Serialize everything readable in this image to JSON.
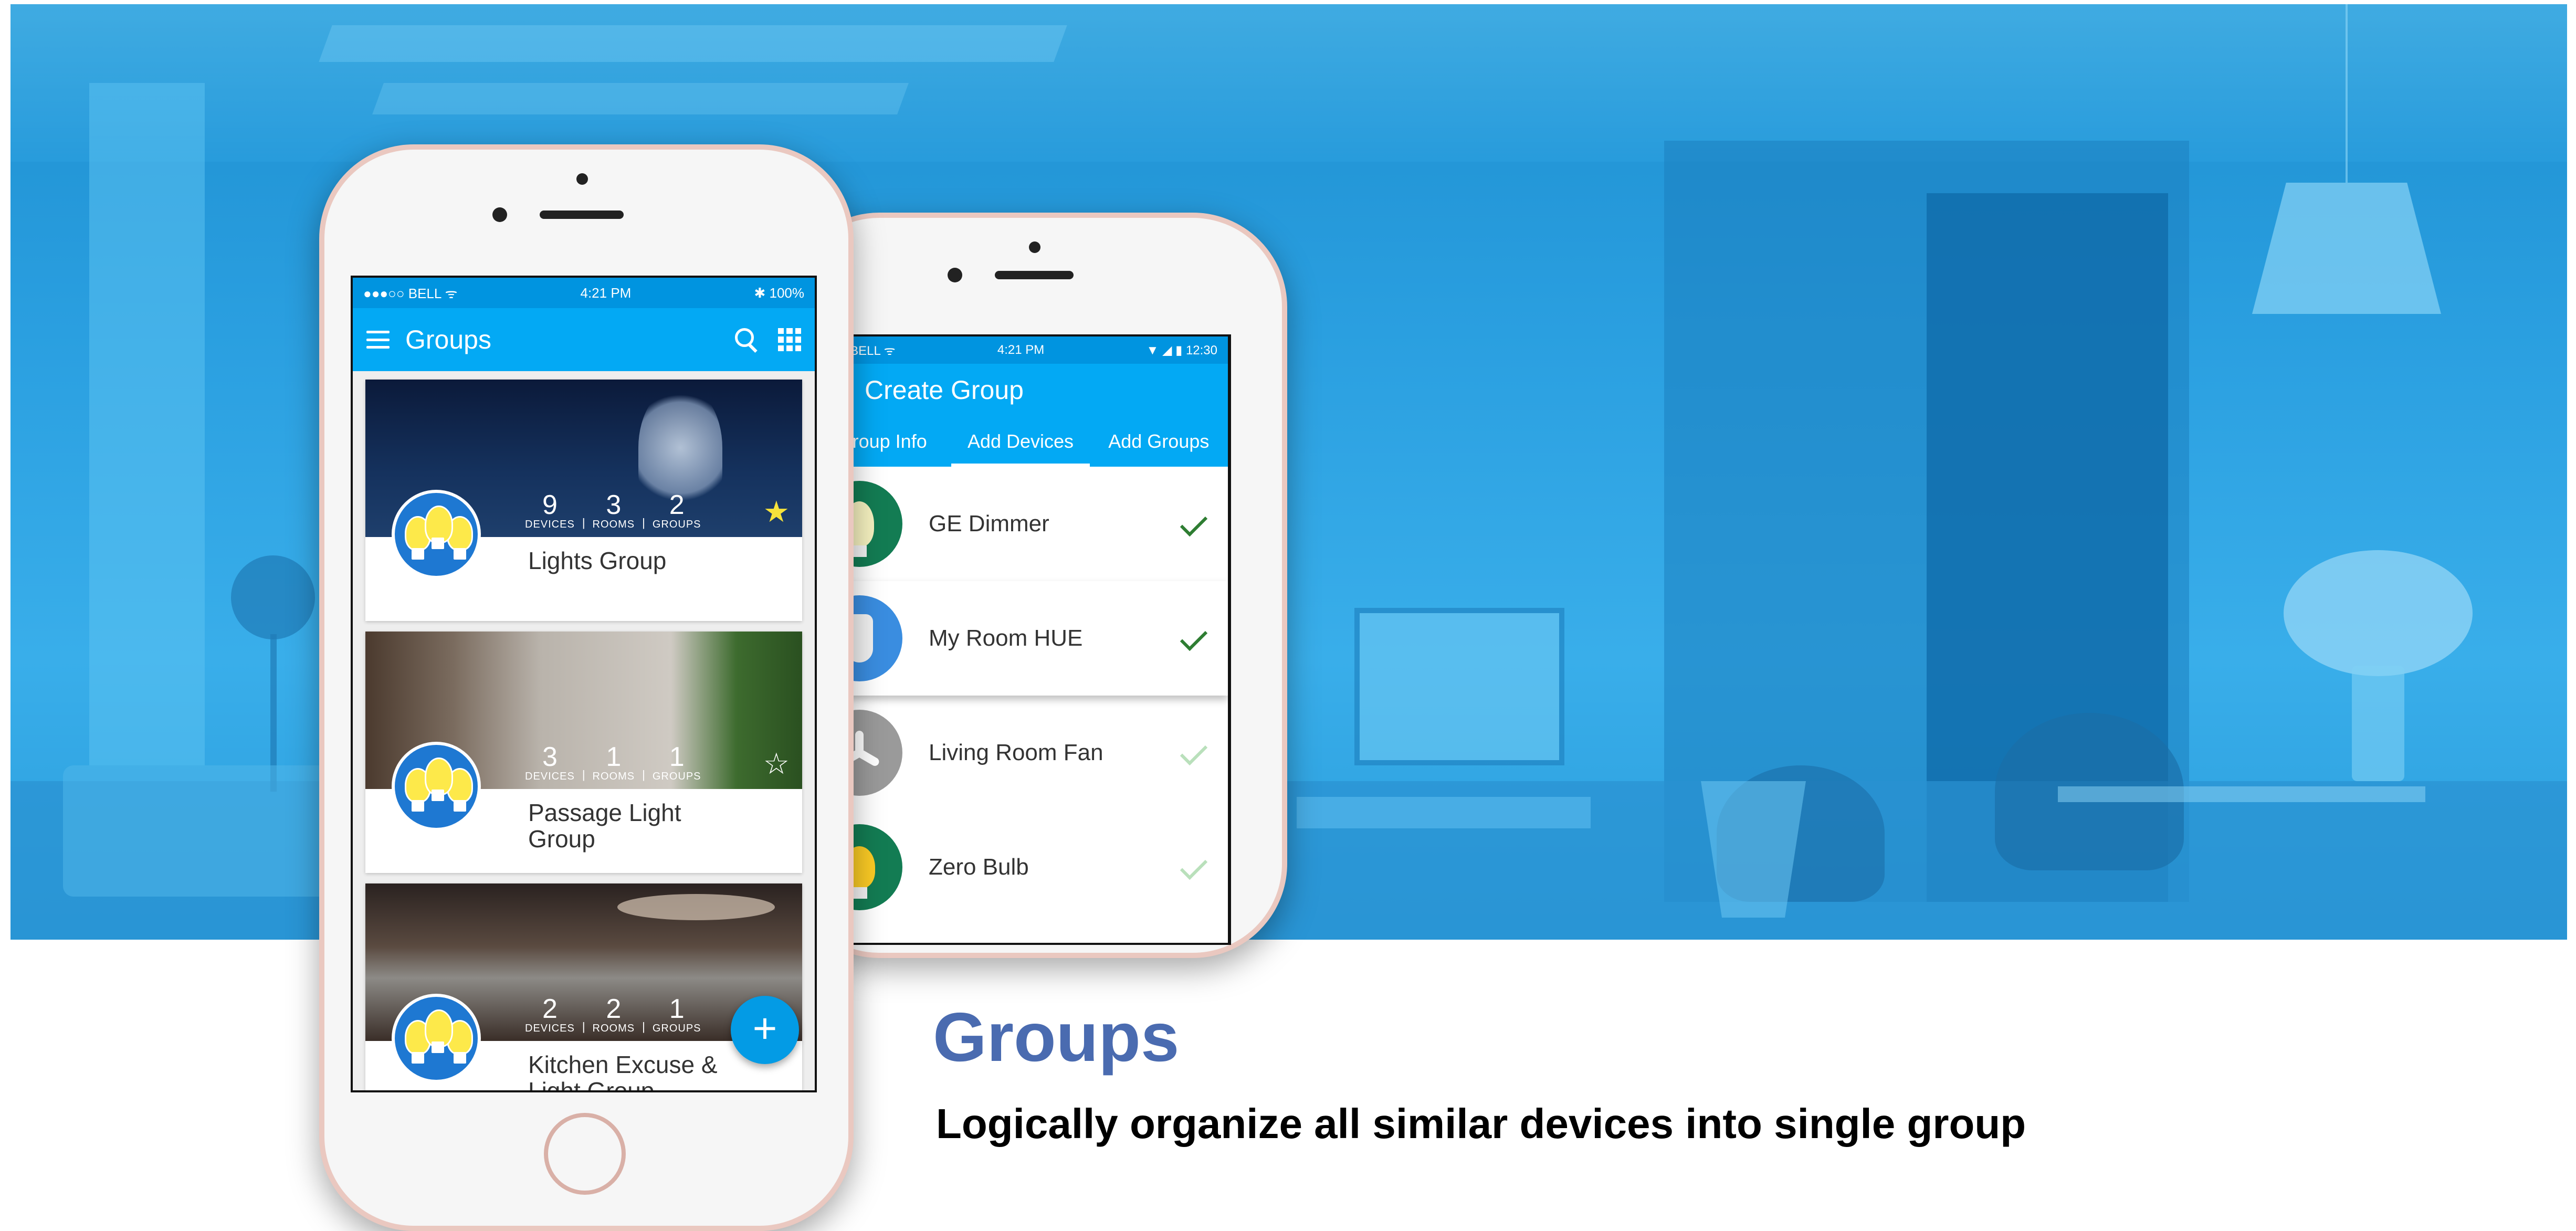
{
  "phone_groups": {
    "status": {
      "carrier": "●●●○○ BELL ᯤ",
      "time": "4:21 PM",
      "battery": "✱ 100%"
    },
    "title": "Groups",
    "cards": [
      {
        "devices": "9",
        "rooms": "3",
        "groups": "2",
        "name": "Lights Group",
        "favorite": true
      },
      {
        "devices": "3",
        "rooms": "1",
        "groups": "1",
        "name": "Passage Light Group",
        "favorite": false
      },
      {
        "devices": "2",
        "rooms": "2",
        "groups": "1",
        "name": "Kitchen Excuse & Light Group",
        "favorite": false
      }
    ],
    "labels": {
      "devices": "DEVICES",
      "rooms": "ROOMS",
      "groups": "GROUPS",
      "sep": "|"
    },
    "fab": "+"
  },
  "phone_create": {
    "status": {
      "carrier": "●○○ BELL ᯤ",
      "time": "4:21 PM",
      "right": "▼ ◢ ▮ 12:30"
    },
    "title": "Create Group",
    "tabs": [
      "Group Info",
      "Add Devices",
      "Add Groups"
    ],
    "active_tab": "Add Devices",
    "devices": [
      {
        "name": "GE Dimmer",
        "icon": "bulb-icon",
        "checked": true
      },
      {
        "name": "My Room HUE",
        "icon": "hue-bulb-icon",
        "checked": true
      },
      {
        "name": "Living Room Fan",
        "icon": "fan-icon",
        "checked": false
      },
      {
        "name": "Zero Bulb",
        "icon": "bulb-icon",
        "checked": false
      }
    ]
  },
  "headline": "Groups",
  "tagline": "Logically organize all similar devices into single group",
  "colors": {
    "accent": "#03a9f4",
    "headline": "#4a6bb0",
    "star": "#f6e23b",
    "check": "#2e7d32"
  }
}
